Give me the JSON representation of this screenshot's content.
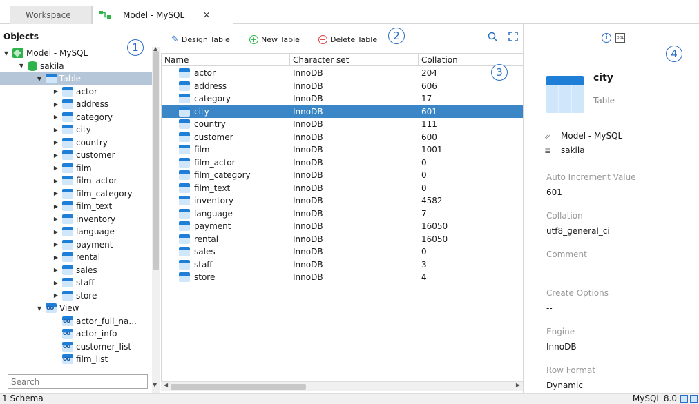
{
  "tabs": {
    "workspace": "Workspace",
    "model": "Model - MySQL",
    "close": "×"
  },
  "left": {
    "title": "Objects",
    "tree": [
      {
        "label": "Model - MySQL",
        "icon": "model",
        "level": 0,
        "caret": "▼"
      },
      {
        "label": "sakila",
        "icon": "db",
        "level": 1,
        "caret": "▼"
      },
      {
        "label": "Table",
        "icon": "table",
        "level": 2,
        "caret": "▼",
        "selected": true
      },
      {
        "label": "actor",
        "icon": "table",
        "level": 3,
        "caret": "▶"
      },
      {
        "label": "address",
        "icon": "table",
        "level": 3,
        "caret": "▶"
      },
      {
        "label": "category",
        "icon": "table",
        "level": 3,
        "caret": "▶"
      },
      {
        "label": "city",
        "icon": "table",
        "level": 3,
        "caret": "▶"
      },
      {
        "label": "country",
        "icon": "table",
        "level": 3,
        "caret": "▶"
      },
      {
        "label": "customer",
        "icon": "table",
        "level": 3,
        "caret": "▶"
      },
      {
        "label": "film",
        "icon": "table",
        "level": 3,
        "caret": "▶"
      },
      {
        "label": "film_actor",
        "icon": "table",
        "level": 3,
        "caret": "▶"
      },
      {
        "label": "film_category",
        "icon": "table",
        "level": 3,
        "caret": "▶"
      },
      {
        "label": "film_text",
        "icon": "table",
        "level": 3,
        "caret": "▶"
      },
      {
        "label": "inventory",
        "icon": "table",
        "level": 3,
        "caret": "▶"
      },
      {
        "label": "language",
        "icon": "table",
        "level": 3,
        "caret": "▶"
      },
      {
        "label": "payment",
        "icon": "table",
        "level": 3,
        "caret": "▶"
      },
      {
        "label": "rental",
        "icon": "table",
        "level": 3,
        "caret": "▶"
      },
      {
        "label": "sales",
        "icon": "table",
        "level": 3,
        "caret": "▶"
      },
      {
        "label": "staff",
        "icon": "table",
        "level": 3,
        "caret": "▶"
      },
      {
        "label": "store",
        "icon": "table",
        "level": 3,
        "caret": "▶"
      },
      {
        "label": "View",
        "icon": "view",
        "level": 2,
        "caret": "▼"
      },
      {
        "label": "actor_full_na...",
        "icon": "view",
        "level": 3,
        "caret": ""
      },
      {
        "label": "actor_info",
        "icon": "view",
        "level": 3,
        "caret": ""
      },
      {
        "label": "customer_list",
        "icon": "view",
        "level": 3,
        "caret": ""
      },
      {
        "label": "film_list",
        "icon": "view",
        "level": 3,
        "caret": ""
      }
    ],
    "search_placeholder": "Search"
  },
  "toolbar": {
    "design": "Design Table",
    "new": "New Table",
    "delete": "Delete Table"
  },
  "grid": {
    "headers": [
      "Name",
      "Character set",
      "Collation"
    ],
    "rows": [
      [
        "actor",
        "InnoDB",
        "204"
      ],
      [
        "address",
        "InnoDB",
        "606"
      ],
      [
        "category",
        "InnoDB",
        "17"
      ],
      [
        "city",
        "InnoDB",
        "601"
      ],
      [
        "country",
        "InnoDB",
        "111"
      ],
      [
        "customer",
        "InnoDB",
        "600"
      ],
      [
        "film",
        "InnoDB",
        "1001"
      ],
      [
        "film_actor",
        "InnoDB",
        "0"
      ],
      [
        "film_category",
        "InnoDB",
        "0"
      ],
      [
        "film_text",
        "InnoDB",
        "0"
      ],
      [
        "inventory",
        "InnoDB",
        "4582"
      ],
      [
        "language",
        "InnoDB",
        "7"
      ],
      [
        "payment",
        "InnoDB",
        "16050"
      ],
      [
        "rental",
        "InnoDB",
        "16050"
      ],
      [
        "sales",
        "InnoDB",
        "0"
      ],
      [
        "staff",
        "InnoDB",
        "3"
      ],
      [
        "store",
        "InnoDB",
        "4"
      ]
    ],
    "selected_index": 3
  },
  "info": {
    "ddl_label": "DDL",
    "info_glyph": "i",
    "name": "city",
    "type": "Table",
    "model": "Model - MySQL",
    "schema": "sakila",
    "props": [
      {
        "label": "Auto Increment Value",
        "value": "601"
      },
      {
        "label": "Collation",
        "value": "utf8_general_ci"
      },
      {
        "label": "Comment",
        "value": "--"
      },
      {
        "label": "Create Options",
        "value": "--"
      },
      {
        "label": "Engine",
        "value": "InnoDB"
      },
      {
        "label": "Row Format",
        "value": "Dynamic"
      }
    ]
  },
  "callouts": [
    "1",
    "2",
    "3",
    "4"
  ],
  "status": {
    "left": "1 Schema",
    "right": "MySQL 8.0"
  },
  "colors": {
    "accent": "#2b6fc4",
    "selection": "#3a86c6",
    "tree_selection": "#b4c6d8",
    "db_green": "#2db34a",
    "delete_red": "#e03a3a"
  }
}
